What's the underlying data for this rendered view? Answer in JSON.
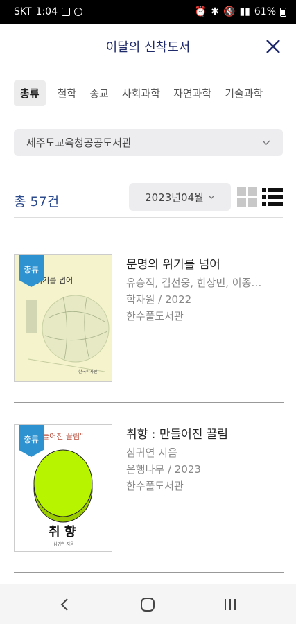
{
  "status_bar": {
    "carrier": "SKT",
    "time": "1:04",
    "battery": "61%"
  },
  "header": {
    "title": "이달의 신착도서"
  },
  "tabs": [
    "총류",
    "철학",
    "종교",
    "사회과학",
    "자연과학",
    "기술과학"
  ],
  "library_select": {
    "value": "제주도교육청공공도서관"
  },
  "list_meta": {
    "total": "총 57건",
    "month": "2023년04월"
  },
  "books": [
    {
      "title": "문명의 위기를 넘어",
      "authors": "유승직, 김선웅, 한상민, 이종…",
      "publisher_year": "학자원 / 2022",
      "library": "한수풀도서관",
      "category_badge": "총류",
      "cover_title": "위기를 넘어",
      "cover_publisher": "한국학자원"
    },
    {
      "title": "취향 : 만들어진 끌림",
      "authors": "심귀연 지음",
      "publisher_year": "은행나무 / 2023",
      "library": "한수풀도서관",
      "category_badge": "총류",
      "cover_tagline": "들어진 끌림\"",
      "cover_title": "취 향",
      "cover_author": "심귀연 지음"
    }
  ],
  "colors": {
    "accent": "#1f2a6b",
    "count": "#2c4a8e",
    "badge": "#2e92d0",
    "cover_disc": "#b7f400"
  }
}
